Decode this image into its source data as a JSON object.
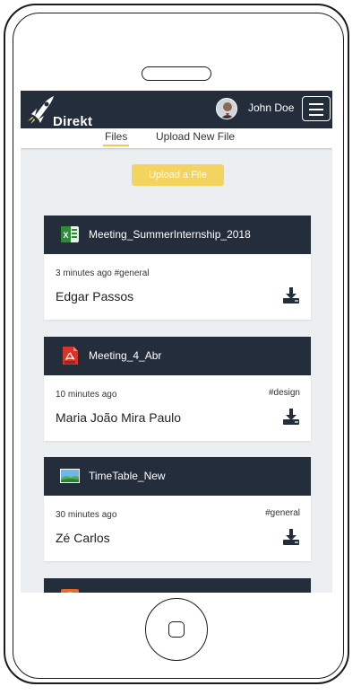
{
  "app": {
    "brand": "Direkt",
    "accent": "#f4d35e",
    "navbar_color": "#232d3b"
  },
  "user": {
    "name": "John Doe"
  },
  "tabs": {
    "files": "Files",
    "upload": "Upload New File"
  },
  "upload_button": "Upload a File",
  "files": [
    {
      "name": "Meeting_SummerInternship_2018",
      "icon": "excel-icon",
      "time": "3 minutes ago #general",
      "tag": "",
      "owner": "Edgar Passos"
    },
    {
      "name": "Meeting_4_Abr",
      "icon": "pdf-icon",
      "time": "10 minutes ago",
      "tag": "#design",
      "owner": "Maria João Mira Paulo"
    },
    {
      "name": "TimeTable_New",
      "icon": "image-icon",
      "time": "30 minutes ago",
      "tag": "#general",
      "owner": "Zé Carlos"
    }
  ]
}
